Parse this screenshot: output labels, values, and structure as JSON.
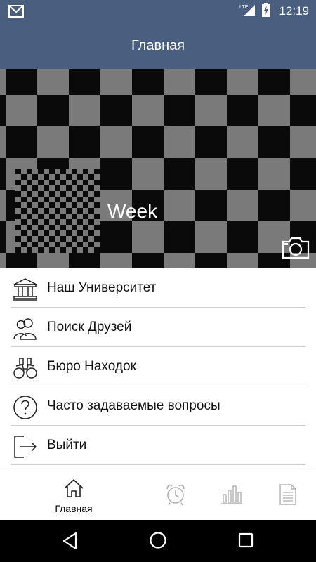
{
  "status_bar": {
    "network": "LTE",
    "time": "12:19"
  },
  "app_bar": {
    "title": "Главная"
  },
  "profile": {
    "name": "Week"
  },
  "menu": [
    {
      "label": "Наш Университет",
      "icon": "university-icon"
    },
    {
      "label": "Поиск Друзей",
      "icon": "people-icon"
    },
    {
      "label": "Бюро Находок",
      "icon": "binoculars-icon"
    },
    {
      "label": "Часто задаваемые вопросы",
      "icon": "question-icon"
    },
    {
      "label": "Выйти",
      "icon": "logout-icon"
    }
  ],
  "bottom_nav": {
    "home_label": "Главная"
  },
  "colors": {
    "primary": "#4a5f7f",
    "checker_dark": "#0a0a0a",
    "checker_light": "#7a7a7a",
    "inactive_icon": "#b0b0b0"
  }
}
